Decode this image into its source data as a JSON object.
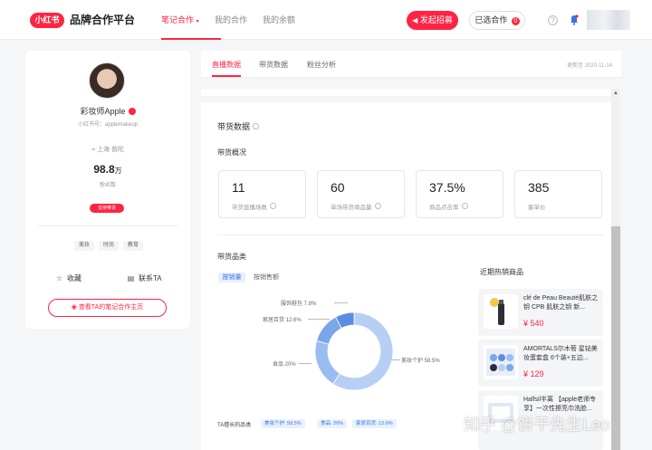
{
  "brand": {
    "badge": "小红书",
    "title": "品牌合作平台"
  },
  "nav": {
    "items": [
      "笔记合作",
      "我的合作",
      "我的余额"
    ],
    "active": 0
  },
  "header": {
    "publish_label": "发起招募",
    "selected_label": "已选合作",
    "selected_count": "0",
    "help": "?"
  },
  "profile": {
    "name": "彩妆师Apple",
    "id_text": "小红书号：applemakeup",
    "location": "上海 普陀",
    "fans_value": "98.8",
    "fans_unit": "万",
    "fans_label": "粉丝数",
    "tag": "支持带货",
    "categories": [
      "美妆",
      "时尚",
      "教育"
    ],
    "favorite_label": "收藏",
    "contact_label": "联系TA",
    "notes_link": "查看TA的笔记合作主页"
  },
  "tabs": {
    "items": [
      "直播数据",
      "带货数据",
      "粉丝分析"
    ],
    "active": 0,
    "update_time": "更新至 2020-11-14"
  },
  "sales": {
    "title": "带货数据",
    "overview_title": "带货概况",
    "stats": [
      {
        "value": "11",
        "label": "带货直播场数"
      },
      {
        "value": "60",
        "label": "单场带货商品量"
      },
      {
        "value": "37.5%",
        "label": "商品点击率"
      },
      {
        "value": "385",
        "label": "客单价"
      }
    ],
    "category_title": "带货品类",
    "segments": [
      "按销量",
      "按销售额"
    ],
    "ta_label": "TA擅长的品类",
    "ta_chips": [
      "美妆个护: 58.5%",
      "食品: 20%",
      "家居百货: 12.6%"
    ]
  },
  "chart_data": {
    "type": "pie",
    "donut": true,
    "categories": [
      "美妆个护",
      "食品",
      "家居百货",
      "服饰鞋包"
    ],
    "values": [
      58.5,
      20,
      12.6,
      7.8
    ],
    "labels": [
      "美妆个护 58.5%",
      "食品 20%",
      "家居百货 12.6%",
      "服饰鞋包 7.8%"
    ],
    "colors": [
      "#b7cff5",
      "#9bbcf0",
      "#7aa6ea",
      "#5b8ee3"
    ]
  },
  "hot": {
    "title": "近期热销商品",
    "items": [
      {
        "name": "clé de Peau Beauté肌肤之钥 CPB 肌肤之钥 新...",
        "price": "¥ 540",
        "icon": "serum-bottle"
      },
      {
        "name": "AMORTALS尔木萄 星钻美妆蛋套盒 6个装+五边...",
        "price": "¥ 129",
        "icon": "makeup-sponge-box"
      },
      {
        "name": "Halfsil半离 【apple老师专享】一次性擦亮巾洗脸...",
        "price": "",
        "icon": "face-towel"
      }
    ]
  },
  "watermark": "知乎 @饼干先生Leo"
}
